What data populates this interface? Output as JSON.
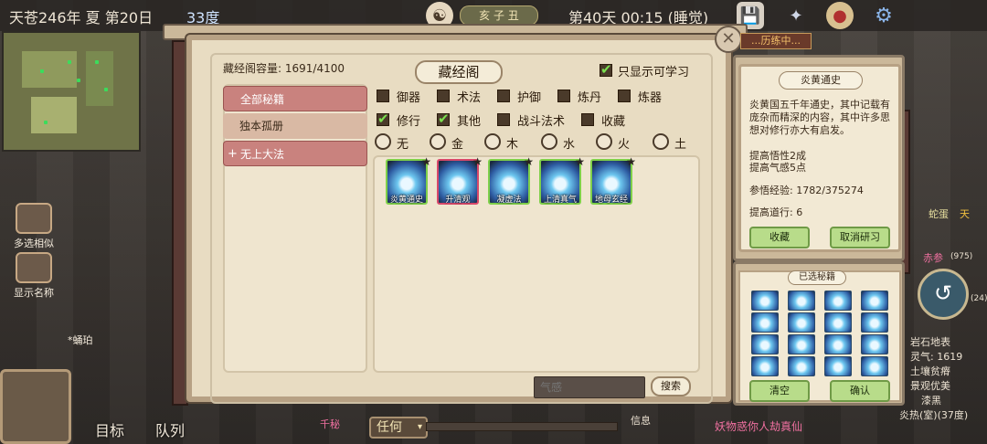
{
  "topbar": {
    "calendar": "天苍246年 夏 第20日",
    "temperature": "33度",
    "date_plate": "亥 子 丑",
    "day_time": "第40天 00:15 (睡觉)"
  },
  "world": {
    "multi_select_label": "多选相似",
    "show_names_label": "显示名称",
    "target_label": "目标",
    "team_label": "队列",
    "anyway_label": "任何",
    "notice_label": "信息",
    "quest_banner": "...历练中...",
    "bottom_event": "妖物惑你人劫真仙",
    "bottom_left_name": "千秘",
    "right_names": [
      "蛇蛋",
      "天",
      "赤参",
      "(975)",
      "(24)"
    ],
    "right_stats": [
      "岩石地表",
      "灵气: 1619",
      "土壤贫瘠",
      "景观优美",
      "漆黑",
      "炎热(室)(37度)"
    ],
    "npc_label": "*蛹珀"
  },
  "panel": {
    "capacity": "藏经阁容量: 1691/4100",
    "title": "藏经阁",
    "only_learnable": "只显示可学习",
    "only_learnable_checked": true,
    "categories": [
      {
        "label": "全部秘籍",
        "active": true
      },
      {
        "label": "独本孤册",
        "active": false
      },
      {
        "label": "无上大法",
        "active": false,
        "plus": "+"
      }
    ],
    "filters_row1": [
      {
        "label": "御器",
        "checked": false
      },
      {
        "label": "术法",
        "checked": false
      },
      {
        "label": "护御",
        "checked": false
      },
      {
        "label": "炼丹",
        "checked": false
      },
      {
        "label": "炼器",
        "checked": false
      }
    ],
    "filters_row2": [
      {
        "label": "修行",
        "checked": true
      },
      {
        "label": "其他",
        "checked": true
      },
      {
        "label": "战斗法术",
        "checked": false
      },
      {
        "label": "收藏",
        "checked": false
      }
    ],
    "elements": [
      "无",
      "金",
      "木",
      "水",
      "火",
      "土"
    ],
    "books": [
      {
        "name": "炎黄通史",
        "frame": "green"
      },
      {
        "name": "升清观",
        "frame": "red"
      },
      {
        "name": "凝虚法",
        "frame": "green"
      },
      {
        "name": "上清真气",
        "frame": "green"
      },
      {
        "name": "地母玄经",
        "frame": "green"
      }
    ],
    "search_placeholder": "气感",
    "search_button": "搜索",
    "close_symbol": "✕"
  },
  "info": {
    "title": "炎黄通史",
    "description": "炎黄国五千年通史，其中记载有庞杂而精深的内容，其中许多思想对修行亦大有启发。",
    "effect1": "提高悟性2成",
    "effect2": "提高气感5点",
    "exp": "参悟经验: 1782/375274",
    "daoxing": "提高道行: 6",
    "collect_button": "收藏",
    "cancel_study_button": "取消研习"
  },
  "selected": {
    "title": "已选秘籍",
    "count": 16,
    "clear_button": "清空",
    "confirm_button": "确认"
  }
}
